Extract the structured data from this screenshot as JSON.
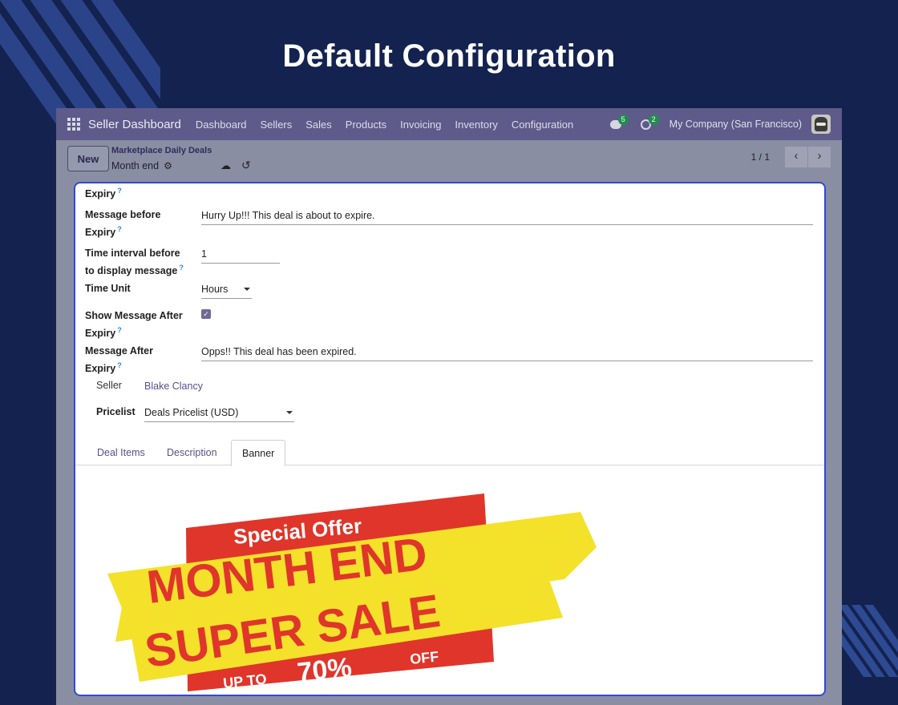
{
  "page": {
    "title": "Default Configuration"
  },
  "navbar": {
    "brand": "Seller Dashboard",
    "menu": [
      "Dashboard",
      "Sellers",
      "Sales",
      "Products",
      "Invoicing",
      "Inventory",
      "Configuration"
    ],
    "messages_count": "5",
    "activities_count": "2",
    "company": "My Company (San Francisco)"
  },
  "control_panel": {
    "new_label": "New",
    "breadcrumb": "Marketplace Daily Deals",
    "record_name": "Month end",
    "pager": "1 / 1"
  },
  "form": {
    "expiry_top_label": "Expiry",
    "message_before_label": "Message before Expiry",
    "message_before_value": "Hurry Up!!! This deal is about to expire.",
    "interval_label": "Time interval before to display message",
    "interval_value": "1",
    "time_unit_label": "Time Unit",
    "time_unit_value": "Hours",
    "show_after_label": "Show Message After Expiry",
    "show_after_checked": true,
    "message_after_label": "Message After Expiry",
    "message_after_value": "Opps!! This deal has been expired.",
    "seller_label": "Seller",
    "seller_value": "Blake Clancy",
    "pricelist_label": "Pricelist",
    "pricelist_value": "Deals Pricelist (USD)"
  },
  "tabs": [
    "Deal Items",
    "Description",
    "Banner"
  ],
  "active_tab": "Banner",
  "banner": {
    "line1": "Special Offer",
    "line2": "MONTH END",
    "line3": "SUPER SALE",
    "line4_prefix": "UP TO",
    "line4_value": "70%",
    "line4_suffix": "OFF"
  },
  "colors": {
    "page_bg": "#13224f",
    "navbar": "#5e5a8a",
    "accent_border": "#2f49d6",
    "banner_red": "#e0352a",
    "banner_yellow": "#f4e12a"
  }
}
